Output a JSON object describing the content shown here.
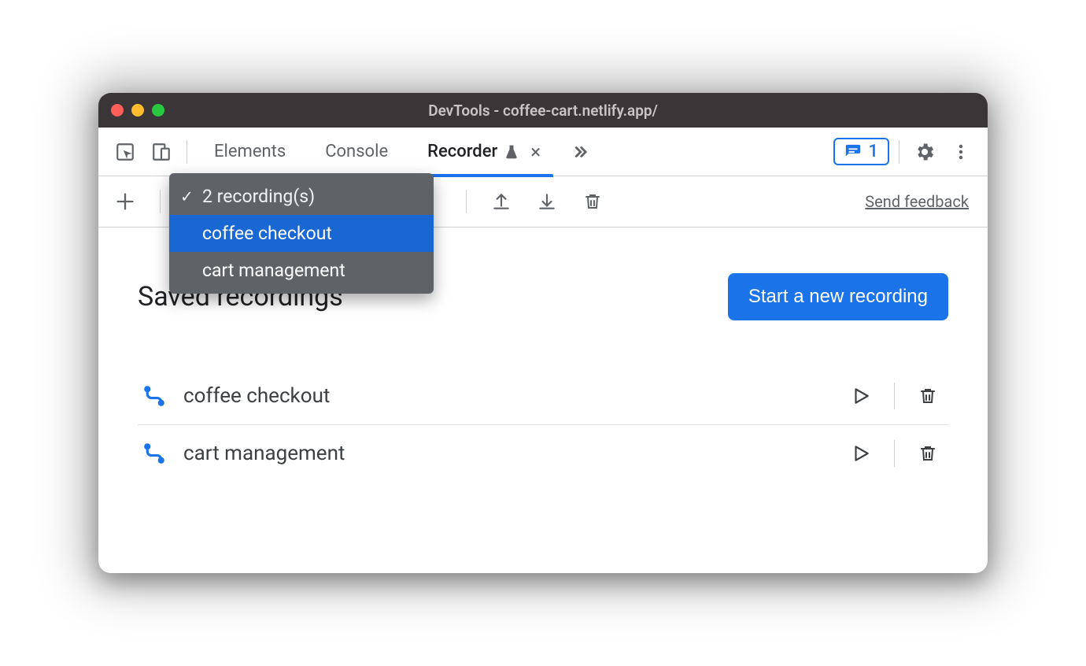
{
  "window": {
    "title": "DevTools - coffee-cart.netlify.app/"
  },
  "tabs": {
    "elements": "Elements",
    "console": "Console",
    "recorder": "Recorder"
  },
  "issues": {
    "count": "1"
  },
  "dropdown": {
    "header": "2 recording(s)",
    "items": [
      "coffee checkout",
      "cart management"
    ]
  },
  "toolbar": {
    "feedback": "Send feedback"
  },
  "body": {
    "title": "Saved recordings",
    "start_btn": "Start a new recording"
  },
  "recordings": [
    {
      "name": "coffee checkout"
    },
    {
      "name": "cart management"
    }
  ]
}
